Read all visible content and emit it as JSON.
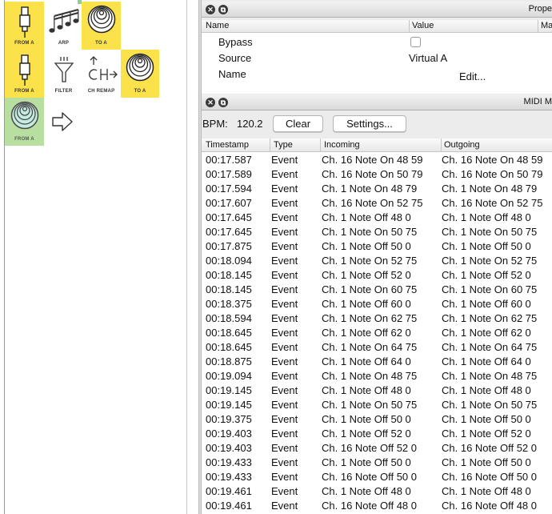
{
  "canvas": {
    "nodes": [
      {
        "label": "FROM A",
        "icon": "midi-plug-icon",
        "style": "yellow"
      },
      {
        "label": "ARP",
        "icon": "arpeggiator-notes-icon",
        "style": "grey"
      },
      {
        "label": "TO A",
        "icon": "speaker-rings-icon",
        "style": "yellow"
      },
      {
        "label": "FROM A",
        "icon": "midi-plug-icon",
        "style": "yellow"
      },
      {
        "label": "FILTER",
        "icon": "filter-funnel-icon",
        "style": "grey"
      },
      {
        "label": "CH REMAP",
        "icon": "channel-remap-icon",
        "style": "grey"
      },
      {
        "label": "TO A",
        "icon": "speaker-rings-icon",
        "style": "yellow"
      },
      {
        "label": "FROM A",
        "icon": "speaker-rings-icon",
        "style": "green"
      }
    ],
    "arrow_icon": "right-arrow-icon"
  },
  "properties": {
    "title": "Prope",
    "columns": {
      "name": "Name",
      "value": "Value",
      "extra": "Ma"
    },
    "rows": [
      {
        "name": "Bypass",
        "value": ""
      },
      {
        "name": "Source",
        "value": "Virtual A"
      },
      {
        "name": "Name",
        "value": "Edit..."
      }
    ]
  },
  "midi_monitor": {
    "title": "MIDI M",
    "bpm_label": "BPM:",
    "bpm_value": "120.2",
    "clear_label": "Clear",
    "settings_label": "Settings...",
    "columns": {
      "timestamp": "Timestamp",
      "type": "Type",
      "incoming": "Incoming",
      "outgoing": "Outgoing"
    },
    "rows": [
      {
        "ts": "00:17.587",
        "type": "Event",
        "in": "Ch. 16 Note On 48 59",
        "out": "Ch. 16 Note On 48 59"
      },
      {
        "ts": "00:17.589",
        "type": "Event",
        "in": "Ch. 16 Note On 50 79",
        "out": "Ch. 16 Note On 50 79"
      },
      {
        "ts": "00:17.594",
        "type": "Event",
        "in": "Ch. 1 Note On 48 79",
        "out": "Ch. 1 Note On 48 79"
      },
      {
        "ts": "00:17.607",
        "type": "Event",
        "in": "Ch. 16 Note On 52 75",
        "out": "Ch. 16 Note On 52 75"
      },
      {
        "ts": "00:17.645",
        "type": "Event",
        "in": "Ch. 1 Note Off 48 0",
        "out": "Ch. 1 Note Off 48 0"
      },
      {
        "ts": "00:17.645",
        "type": "Event",
        "in": "Ch. 1 Note On 50 75",
        "out": "Ch. 1 Note On 50 75"
      },
      {
        "ts": "00:17.875",
        "type": "Event",
        "in": "Ch. 1 Note Off 50 0",
        "out": "Ch. 1 Note Off 50 0"
      },
      {
        "ts": "00:18.094",
        "type": "Event",
        "in": "Ch. 1 Note On 52 75",
        "out": "Ch. 1 Note On 52 75"
      },
      {
        "ts": "00:18.145",
        "type": "Event",
        "in": "Ch. 1 Note Off 52 0",
        "out": "Ch. 1 Note Off 52 0"
      },
      {
        "ts": "00:18.145",
        "type": "Event",
        "in": "Ch. 1 Note On 60 75",
        "out": "Ch. 1 Note On 60 75"
      },
      {
        "ts": "00:18.375",
        "type": "Event",
        "in": "Ch. 1 Note Off 60 0",
        "out": "Ch. 1 Note Off 60 0"
      },
      {
        "ts": "00:18.594",
        "type": "Event",
        "in": "Ch. 1 Note On 62 75",
        "out": "Ch. 1 Note On 62 75"
      },
      {
        "ts": "00:18.645",
        "type": "Event",
        "in": "Ch. 1 Note Off 62 0",
        "out": "Ch. 1 Note Off 62 0"
      },
      {
        "ts": "00:18.645",
        "type": "Event",
        "in": "Ch. 1 Note On 64 75",
        "out": "Ch. 1 Note On 64 75"
      },
      {
        "ts": "00:18.875",
        "type": "Event",
        "in": "Ch. 1 Note Off 64 0",
        "out": "Ch. 1 Note Off 64 0"
      },
      {
        "ts": "00:19.094",
        "type": "Event",
        "in": "Ch. 1 Note On 48 75",
        "out": "Ch. 1 Note On 48 75"
      },
      {
        "ts": "00:19.145",
        "type": "Event",
        "in": "Ch. 1 Note Off 48 0",
        "out": "Ch. 1 Note Off 48 0"
      },
      {
        "ts": "00:19.145",
        "type": "Event",
        "in": "Ch. 1 Note On 50 75",
        "out": "Ch. 1 Note On 50 75"
      },
      {
        "ts": "00:19.375",
        "type": "Event",
        "in": "Ch. 1 Note Off 50 0",
        "out": "Ch. 1 Note Off 50 0"
      },
      {
        "ts": "00:19.403",
        "type": "Event",
        "in": "Ch. 1 Note Off 52 0",
        "out": "Ch. 1 Note Off 52 0"
      },
      {
        "ts": "00:19.403",
        "type": "Event",
        "in": "Ch. 16 Note Off 52 0",
        "out": "Ch. 16 Note Off 52 0"
      },
      {
        "ts": "00:19.433",
        "type": "Event",
        "in": "Ch. 1 Note Off 50 0",
        "out": "Ch. 1 Note Off 50 0"
      },
      {
        "ts": "00:19.433",
        "type": "Event",
        "in": "Ch. 16 Note Off 50 0",
        "out": "Ch. 16 Note Off 50 0"
      },
      {
        "ts": "00:19.461",
        "type": "Event",
        "in": "Ch. 1 Note Off 48 0",
        "out": "Ch. 1 Note Off 48 0"
      },
      {
        "ts": "00:19.461",
        "type": "Event",
        "in": "Ch. 16 Note Off 48 0",
        "out": "Ch. 16 Note Off 48 0"
      }
    ]
  }
}
